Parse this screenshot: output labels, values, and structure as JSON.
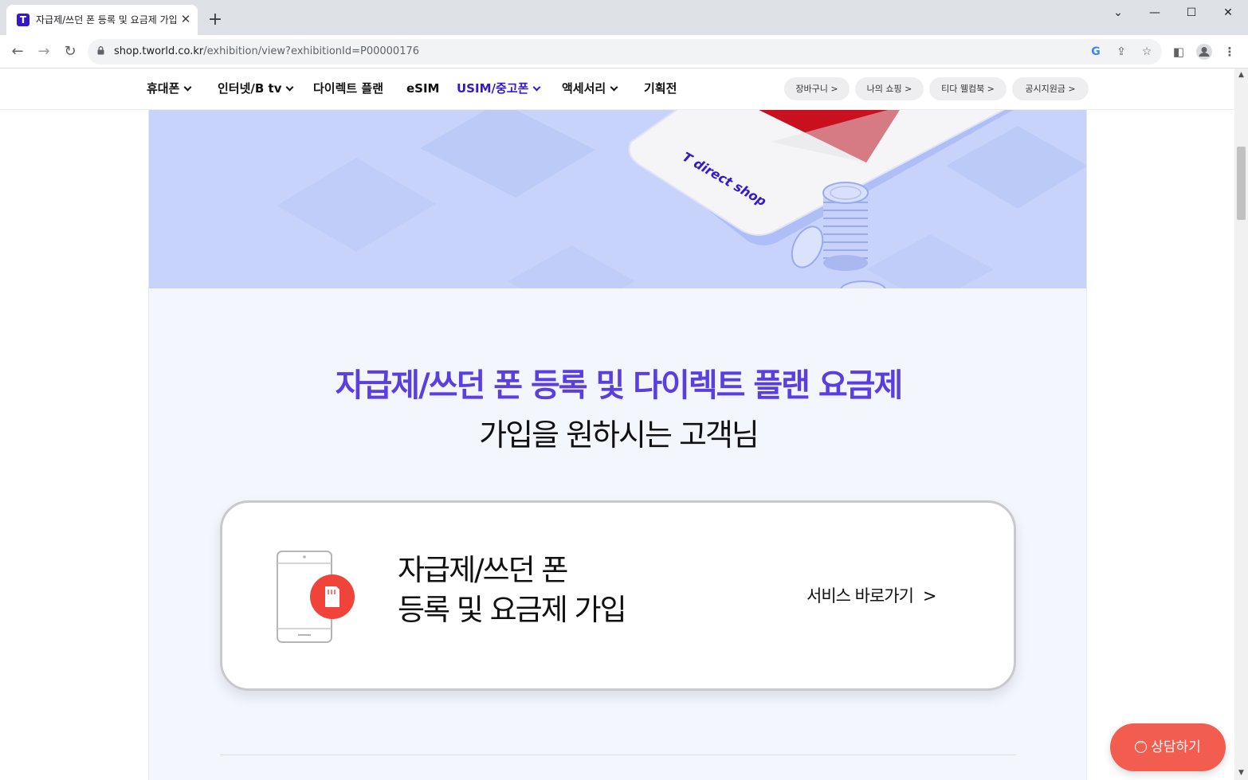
{
  "browser": {
    "tab": {
      "favicon": "T",
      "title": "자급제/쓰던 폰 등록 및 요금제 가입"
    },
    "window_controls": {
      "tabsearch": "⌄",
      "minimize": "—",
      "maximize": "☐",
      "close": "✕"
    },
    "url_host": "shop.tworld.co.kr",
    "url_path": "/exhibition/view?exhibitionId=P00000176",
    "icons": [
      "back-icon",
      "forward-icon",
      "reload-icon",
      "lock-icon",
      "google-icon",
      "share-icon",
      "star-icon",
      "sidepanel-icon",
      "profile-icon",
      "menu-icon"
    ]
  },
  "site_nav": {
    "items": [
      {
        "label": "휴대폰",
        "dropdown": true
      },
      {
        "label": "인터넷/B tv",
        "dropdown": true
      },
      {
        "label": "다이렉트 플랜",
        "dropdown": false
      },
      {
        "label": "eSIM",
        "dropdown": false
      },
      {
        "label": "USIM/중고폰",
        "dropdown": true,
        "active": true
      },
      {
        "label": "액세서리",
        "dropdown": true
      },
      {
        "label": "기획전",
        "dropdown": false
      }
    ],
    "util_links": [
      "장바구니 >",
      "나의 쇼핑 >",
      "티다 웰컴북 >",
      "공시지원금 >"
    ]
  },
  "hero": {
    "brand_text": "T direct shop"
  },
  "intro": {
    "heading_highlight": "자급제/쓰던 폰 등록 및 다이렉트 플랜 요금제",
    "heading_sub": "가입을 원하시는 고객님"
  },
  "service_card": {
    "title_line1": "자급제/쓰던 폰",
    "title_line2": "등록 및 요금제 가입",
    "link_label": "서비스 바로가기",
    "link_arrow": ">"
  },
  "floating": {
    "chat_label": "상담하기"
  },
  "colors": {
    "brand": "#3617ce",
    "heading": "#5a3ee0",
    "hero_bg": "#c8d3fb",
    "page_bg": "#f4f6fe",
    "accent_red": "#f0433a",
    "chat_btn": "#f35d50"
  }
}
